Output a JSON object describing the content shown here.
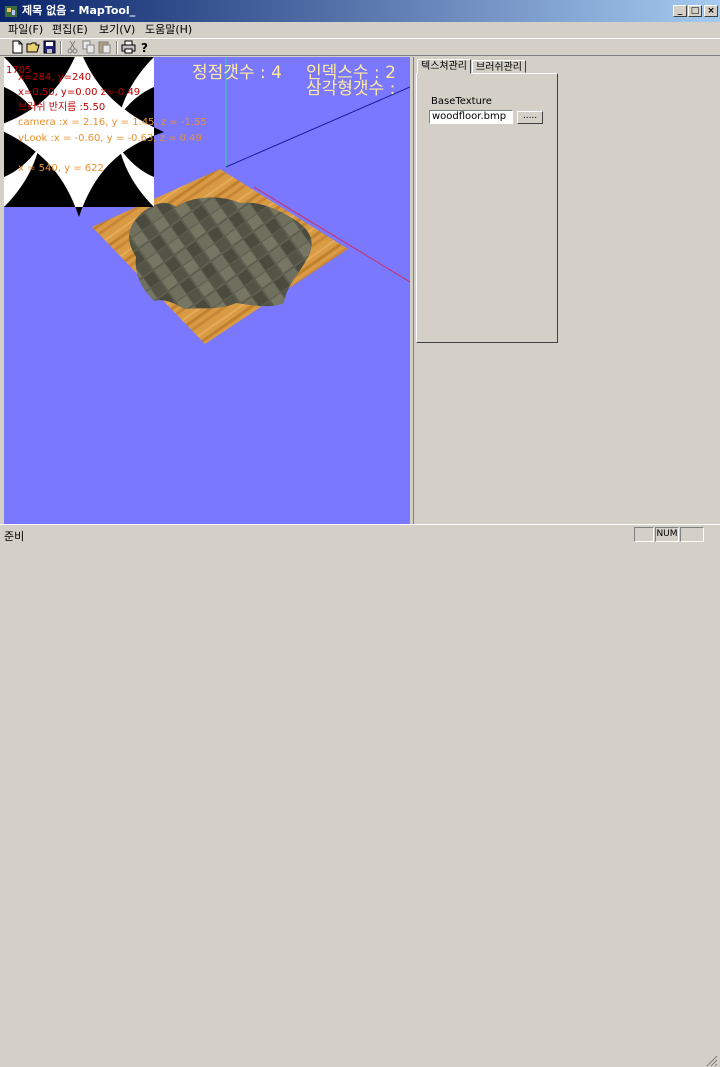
{
  "window": {
    "title": "제목 없음 - MapTool_",
    "minimize_label": "_",
    "maximize_label": "□",
    "close_label": "×"
  },
  "menu": [
    {
      "label": "파일(F)"
    },
    {
      "label": "편집(E)"
    },
    {
      "label": "보기(V)"
    },
    {
      "label": "도움말(H)"
    }
  ],
  "toolbar": {
    "icons": [
      "new-file-icon",
      "open-folder-icon",
      "save-icon",
      "cut-icon",
      "copy-icon",
      "paste-icon",
      "print-icon",
      "help-icon"
    ]
  },
  "viewport": {
    "background": "#7a78ff",
    "overlay": {
      "fps": "1705",
      "mouse_screen": "x=284, y=240",
      "pick_pos": "x=0.50, y=0.00 z=-0.49",
      "brush_radius": "브러쉬 반지름 :5.50",
      "camera": "camera :x = 2.16, y = 1.45, z = -1.55",
      "vlook": "vLook :x = -0.60, y = -0.63, z = 0.49",
      "mouse_window": "x = 540, y = 622",
      "vertex_count": "정점갯수 : 4",
      "index_count": "인덱스수 : 2",
      "triangle_count": "삼각형갯수 :"
    }
  },
  "panel": {
    "tabs": [
      {
        "label": "텍스쳐관리",
        "active": true
      },
      {
        "label": "브러쉬관리",
        "active": false
      }
    ],
    "base_texture_label": "BaseTexture",
    "texture_file": "woodfloor.bmp",
    "browse_label": "....."
  },
  "status": {
    "text": "준비",
    "num_label": "NUM"
  }
}
